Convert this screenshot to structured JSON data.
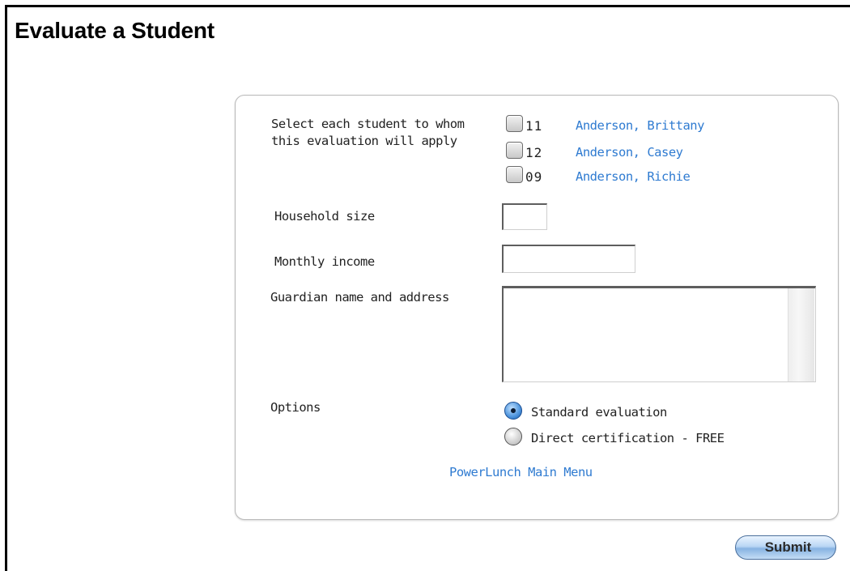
{
  "page": {
    "title": "Evaluate a Student"
  },
  "students": {
    "label": "Select each student to whom\nthis evaluation will apply",
    "items": [
      {
        "grade": "11",
        "name": "Anderson, Brittany"
      },
      {
        "grade": "12",
        "name": "Anderson, Casey"
      },
      {
        "grade": "09",
        "name": "Anderson, Richie"
      }
    ]
  },
  "household": {
    "label": "Household size",
    "value": ""
  },
  "income": {
    "label": "Monthly income",
    "value": ""
  },
  "guardian": {
    "label": "Guardian name and address",
    "value": ""
  },
  "options": {
    "label": "Options",
    "choices": [
      {
        "label": "Standard evaluation",
        "selected": true
      },
      {
        "label": "Direct certification - FREE",
        "selected": false
      }
    ]
  },
  "links": {
    "main_menu": "PowerLunch Main Menu"
  },
  "actions": {
    "submit": "Submit"
  },
  "colors": {
    "link": "#2f7bd1",
    "radio_selected": "#4c93dc",
    "submit_button": "#b9d6f4"
  }
}
